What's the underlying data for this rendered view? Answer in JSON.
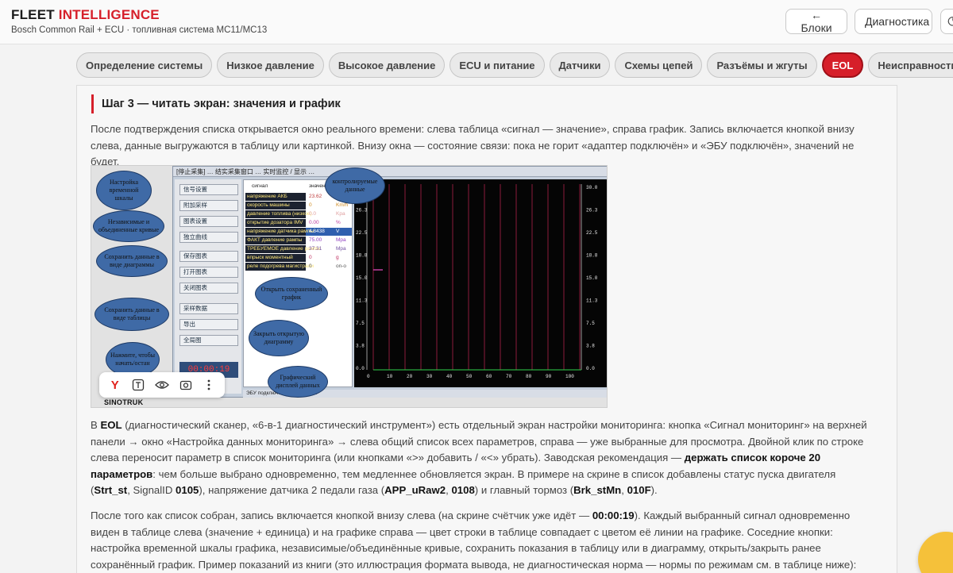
{
  "header": {
    "brand_main": "FLEET",
    "brand_accent": "INTELLIGENCE",
    "subtitle": "Bosch Common Rail + ECU · топливная система MC11/MC13",
    "back_label": "← Блоки",
    "diag_label": "Диагностика"
  },
  "tabs": [
    {
      "label": "Определение системы"
    },
    {
      "label": "Низкое давление"
    },
    {
      "label": "Высокое давление"
    },
    {
      "label": "ECU и питание"
    },
    {
      "label": "Датчики"
    },
    {
      "label": "Схемы цепей"
    },
    {
      "label": "Разъёмы и жгуты"
    },
    {
      "label": "EOL",
      "active": true
    },
    {
      "label": "Неисправности"
    }
  ],
  "section": {
    "heading": "Шаг 3 — читать экран: значения и график",
    "p1": "После подтверждения списка открывается окно реального времени: слева таблица «сигнал — значение», справа график. Запись включается кнопкой внизу слева, данные выгружаются в таблицу или картинкой. Внизу окна — состояние связи: пока не горит «адаптер подключён» и «ЭБУ подключён», значений не будет.",
    "p2": {
      "a": "В ",
      "b1": "EOL",
      "c": " (диагностический сканер, «6-в-1 диагностический инструмент») есть отдельный экран настройки мониторинга: кнопка «Сигнал мониторинг» на верхней панели → окно «Настройка данных мониторинга» → слева общий список всех параметров, справа — уже выбранные для просмотра. Двойной клик по строке слева переносит параметр в список мониторинга (или кнопками «>» добавить / «<» убрать). Заводская рекомендация — ",
      "b2": "держать список короче 20 параметров",
      "d": ": чем больше выбрано одновременно, тем медленнее обновляется экран. В примере на скрине в список добавлены статус пуска двигателя (",
      "b3": "Strt_st",
      "e": ", SignalID ",
      "b4": "0105",
      "f": "), напряжение датчика 2 педали газа (",
      "b5": "APP_uRaw2",
      "g": ", ",
      "b6": "0108",
      "h": ") и главный тормоз (",
      "b7": "Brk_stMn",
      "i": ", ",
      "b8": "010F",
      "j": ")."
    },
    "p3": {
      "a": "После того как список собран, запись включается кнопкой внизу слева (на скрине счётчик уже идёт — ",
      "b1": "00:00:19",
      "c": "). Каждый выбранный сигнал одновременно виден в таблице слева (значение + единица) и на графике справа — цвет строки в таблице совпадает с цветом её линии на графике. Соседние кнопки: настройка временной шкалы графика, независимые/объединённые кривые, сохранить показания в таблицу или в диаграмму, открыть/закрыть ранее сохранённый график. Пример показаний из книги (это иллюстрация формата вывода, не диагностическая норма — нормы по режимам см. в таблице ниже):"
    }
  },
  "figure": {
    "window_title": "[停止采集]  … 结实采集窗口 …   实时监控 / 显示 …",
    "side_buttons": [
      "信号设置",
      "附加采样",
      "图表设置",
      "独立曲线",
      "保存图表",
      "打开图表",
      "关闭图表",
      "采样数据",
      "导出",
      "全局图"
    ],
    "timer": "00:00:19",
    "table_header": [
      "сигнал",
      "значение",
      ""
    ],
    "table_rows": [
      {
        "name": "напряжение АКБ",
        "value": "23.62",
        "unit": "V"
      },
      {
        "name": "скорость машины",
        "value": "0",
        "unit": "Km/h"
      },
      {
        "name": "давление топлива (низкое)",
        "value": "0.0",
        "unit": "Kpa"
      },
      {
        "name": "открытие дозатора IMV",
        "value": "0.00",
        "unit": "%"
      },
      {
        "name": "напряжение датчика рампы",
        "value": "4.8438",
        "unit": "V"
      },
      {
        "name": "ФАКТ давление рампы",
        "value": "75.00",
        "unit": "Mpa"
      },
      {
        "name": "ТРЕБУЕМОЕ давление рампы",
        "value": "37.31",
        "unit": "Mpa"
      },
      {
        "name": "впрыск моментный",
        "value": "0",
        "unit": "g"
      },
      {
        "name": "реле подогрева магистрали",
        "value": "0",
        "unit": "on-o"
      }
    ],
    "y_ticks": [
      "30.0",
      "26.3",
      "22.5",
      "18.8",
      "15.0",
      "11.3",
      "7.5",
      "3.8",
      "0.0"
    ],
    "x_ticks": [
      "0",
      "10",
      "20",
      "30",
      "40",
      "50",
      "60",
      "70",
      "80",
      "90",
      "100"
    ],
    "status_text": "ЭБУ подключён — связь идёт",
    "brand_label": "SINOTRUK",
    "callouts": [
      "Настройка временной шкалы",
      "Независимые и объединенные кривые",
      "Сохранить данные в виде диаграммы",
      "Сохранить данные в виде таблицы",
      "Нажмите, чтобы начать/остан",
      "контролируемые данные",
      "Открыть сохраненный график",
      "Закрыть открытую диаграмму",
      "Графический дисплей данных"
    ]
  },
  "icons": {
    "toolbar": [
      "yandex-icon",
      "text-select-icon",
      "eye-icon",
      "screenshot-icon",
      "more-icon"
    ],
    "theme_button": "moon-icon",
    "chat": "chat-icon"
  },
  "colors": {
    "accent": "#d61f2a",
    "graph_bg": "#050505",
    "graph_lines": "#8b1a3c",
    "chat": "#f5c13a"
  }
}
